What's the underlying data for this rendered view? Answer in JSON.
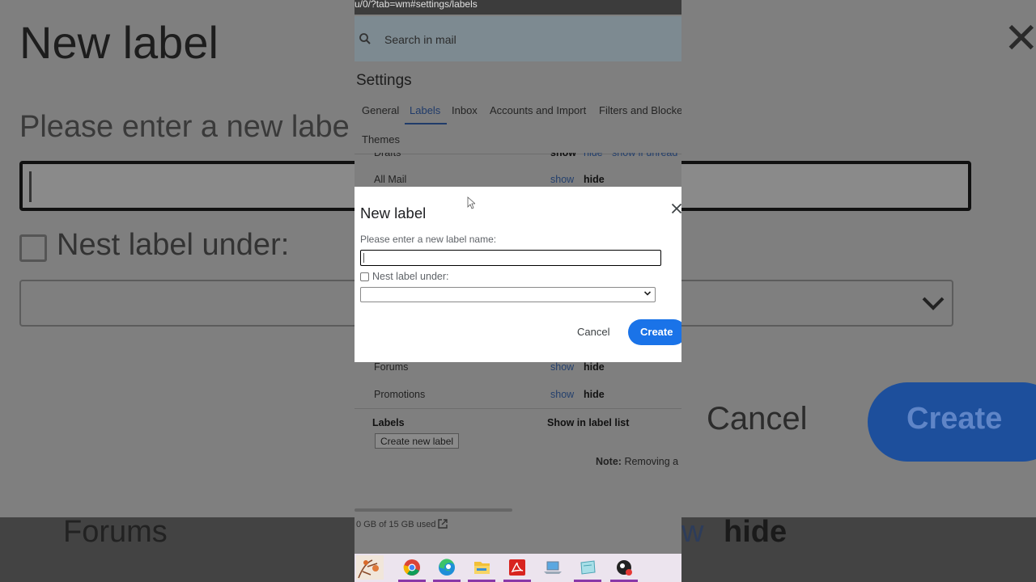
{
  "background": {
    "title": "New label",
    "close_glyph": "✕",
    "prompt": "Please enter a new labe",
    "nest_label": "Nest label under:",
    "cancel": "Cancel",
    "create": "Create",
    "forums": "Forums",
    "hide": "hide",
    "w_fragment": "w"
  },
  "browser": {
    "url_fragment": "u/0/?tab=wm#settings/labels"
  },
  "search": {
    "placeholder": "Search in mail",
    "icon": "search-icon"
  },
  "settings": {
    "title": "Settings",
    "tabs": [
      {
        "label": "General"
      },
      {
        "label": "Labels"
      },
      {
        "label": "Inbox"
      },
      {
        "label": "Accounts and Import"
      },
      {
        "label": "Filters and Blocke"
      }
    ],
    "themes_label": "Themes",
    "active_tab": "Labels"
  },
  "system_labels": [
    {
      "name": "Drafts",
      "show": "show",
      "hide": "hide",
      "extra": "show if unread"
    },
    {
      "name": "All Mail",
      "show": "show",
      "hide": "hide"
    },
    {
      "name": "Forums",
      "show": "show",
      "hide": "hide"
    },
    {
      "name": "Promotions",
      "show": "show",
      "hide": "hide"
    }
  ],
  "labels_section": {
    "heading": "Labels",
    "column_heading": "Show in label list",
    "create_button": "Create new label",
    "note_bold": "Note:",
    "note_text": "Removing a l"
  },
  "storage": {
    "text": "0 GB of 15 GB used"
  },
  "modal": {
    "title": "New label",
    "prompt": "Please enter a new label name:",
    "input_value": "",
    "nest_label": "Nest label under:",
    "nest_checked": false,
    "select_value": "",
    "cancel_label": "Cancel",
    "create_label": "Create"
  },
  "taskbar": {
    "apps": [
      "weather-widget",
      "chrome-icon",
      "edge-icon",
      "file-explorer-icon",
      "acrobat-icon",
      "laptop-icon",
      "notes-icon",
      "recorder-icon"
    ]
  },
  "colors": {
    "accent": "#1a73e8",
    "overlay": "#7f7f7f"
  }
}
